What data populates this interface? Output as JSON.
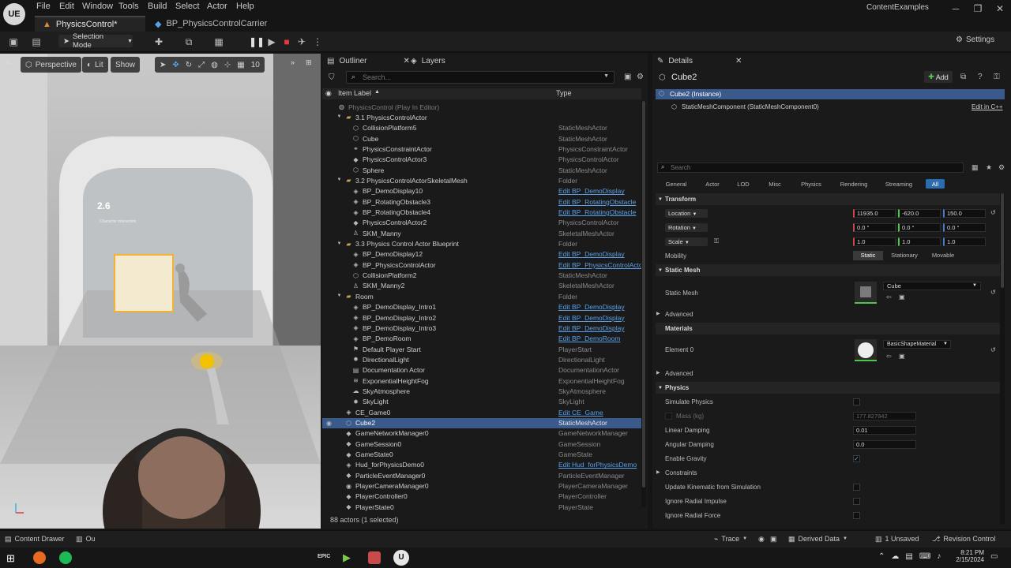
{
  "app": {
    "project_name": "ContentExamples",
    "logo_text": "UE"
  },
  "menu": [
    "File",
    "Edit",
    "Window",
    "Tools",
    "Build",
    "Select",
    "Actor",
    "Help"
  ],
  "tabs": [
    {
      "label": "PhysicsControl*"
    },
    {
      "label": "BP_PhysicsControlCarrier"
    }
  ],
  "toolbar": {
    "mode": "Selection Mode",
    "settings": "Settings"
  },
  "viewport": {
    "perspective": "Perspective",
    "lit": "Lit",
    "show": "Show",
    "grid_size": "10",
    "screen_number": "2.6",
    "screen_heading": "Character interaction"
  },
  "outliner": {
    "tab_label": "Outliner",
    "layers_label": "Layers",
    "search_placeholder": "Search...",
    "col_label": "Item Label",
    "col_type": "Type",
    "status": "88 actors (1 selected)",
    "rows": [
      {
        "label": "PhysicsControl (Play In Editor)",
        "type": "",
        "link": false,
        "indent": 0,
        "icon": "world",
        "selected": false,
        "dim": true
      },
      {
        "label": "3.1 PhysicsControlActor",
        "type": "",
        "link": false,
        "indent": 1,
        "icon": "folder",
        "selected": false,
        "dim": false
      },
      {
        "label": "CollisionPlatform5",
        "type": "StaticMeshActor",
        "link": false,
        "indent": 2,
        "icon": "mesh",
        "selected": false,
        "dim": false
      },
      {
        "label": "Cube",
        "type": "StaticMeshActor",
        "link": false,
        "indent": 2,
        "icon": "mesh",
        "selected": false,
        "dim": false
      },
      {
        "label": "PhysicsConstraintActor",
        "type": "PhysicsConstraintActor",
        "link": false,
        "indent": 2,
        "icon": "constraint",
        "selected": false,
        "dim": false
      },
      {
        "label": "PhysicsControlActor3",
        "type": "PhysicsControlActor",
        "link": false,
        "indent": 2,
        "icon": "actor",
        "selected": false,
        "dim": false
      },
      {
        "label": "Sphere",
        "type": "StaticMeshActor",
        "link": false,
        "indent": 2,
        "icon": "mesh",
        "selected": false,
        "dim": false
      },
      {
        "label": "3.2 PhysicsControlActorSkeletalMesh",
        "type": "Folder",
        "link": false,
        "indent": 1,
        "icon": "folder",
        "selected": false,
        "dim": false
      },
      {
        "label": "BP_DemoDisplay10",
        "type": "Edit BP_DemoDisplay",
        "link": true,
        "indent": 2,
        "icon": "bp",
        "selected": false,
        "dim": false
      },
      {
        "label": "BP_RotatingObstacle3",
        "type": "Edit BP_RotatingObstacle",
        "link": true,
        "indent": 2,
        "icon": "bp",
        "selected": false,
        "dim": false
      },
      {
        "label": "BP_RotatingObstacle4",
        "type": "Edit BP_RotatingObstacle",
        "link": true,
        "indent": 2,
        "icon": "bp",
        "selected": false,
        "dim": false
      },
      {
        "label": "PhysicsControlActor2",
        "type": "PhysicsControlActor",
        "link": false,
        "indent": 2,
        "icon": "actor",
        "selected": false,
        "dim": false
      },
      {
        "label": "SKM_Manny",
        "type": "SkeletalMeshActor",
        "link": false,
        "indent": 2,
        "icon": "skel",
        "selected": false,
        "dim": false
      },
      {
        "label": "3.3 Physics Control Actor Blueprint",
        "type": "Folder",
        "link": false,
        "indent": 1,
        "icon": "folder",
        "selected": false,
        "dim": false
      },
      {
        "label": "BP_DemoDisplay12",
        "type": "Edit BP_DemoDisplay",
        "link": true,
        "indent": 2,
        "icon": "bp",
        "selected": false,
        "dim": false
      },
      {
        "label": "BP_PhysicsControlActor",
        "type": "Edit BP_PhysicsControlActo",
        "link": true,
        "indent": 2,
        "icon": "bp",
        "selected": false,
        "dim": false
      },
      {
        "label": "CollisionPlatform2",
        "type": "StaticMeshActor",
        "link": false,
        "indent": 2,
        "icon": "mesh",
        "selected": false,
        "dim": false
      },
      {
        "label": "SKM_Manny2",
        "type": "SkeletalMeshActor",
        "link": false,
        "indent": 2,
        "icon": "skel",
        "selected": false,
        "dim": false
      },
      {
        "label": "Room",
        "type": "Folder",
        "link": false,
        "indent": 1,
        "icon": "folder",
        "selected": false,
        "dim": false
      },
      {
        "label": "BP_DemoDisplay_Intro1",
        "type": "Edit BP_DemoDisplay",
        "link": true,
        "indent": 2,
        "icon": "bp",
        "selected": false,
        "dim": false
      },
      {
        "label": "BP_DemoDisplay_Intro2",
        "type": "Edit BP_DemoDisplay",
        "link": true,
        "indent": 2,
        "icon": "bp",
        "selected": false,
        "dim": false
      },
      {
        "label": "BP_DemoDisplay_Intro3",
        "type": "Edit BP_DemoDisplay",
        "link": true,
        "indent": 2,
        "icon": "bp",
        "selected": false,
        "dim": false
      },
      {
        "label": "BP_DemoRoom",
        "type": "Edit BP_DemoRoom",
        "link": true,
        "indent": 2,
        "icon": "bp",
        "selected": false,
        "dim": false
      },
      {
        "label": "Default Player Start",
        "type": "PlayerStart",
        "link": false,
        "indent": 2,
        "icon": "start",
        "selected": false,
        "dim": false
      },
      {
        "label": "DirectionalLight",
        "type": "DirectionalLight",
        "link": false,
        "indent": 2,
        "icon": "light",
        "selected": false,
        "dim": false
      },
      {
        "label": "Documentation Actor",
        "type": "DocumentationActor",
        "link": false,
        "indent": 2,
        "icon": "doc",
        "selected": false,
        "dim": false
      },
      {
        "label": "ExponentialHeightFog",
        "type": "ExponentialHeightFog",
        "link": false,
        "indent": 2,
        "icon": "fog",
        "selected": false,
        "dim": false
      },
      {
        "label": "SkyAtmosphere",
        "type": "SkyAtmosphere",
        "link": false,
        "indent": 2,
        "icon": "sky",
        "selected": false,
        "dim": false
      },
      {
        "label": "SkyLight",
        "type": "SkyLight",
        "link": false,
        "indent": 2,
        "icon": "light",
        "selected": false,
        "dim": false
      },
      {
        "label": "CE_Game0",
        "type": "Edit CE_Game",
        "link": true,
        "indent": 1,
        "icon": "bp",
        "selected": false,
        "dim": false
      },
      {
        "label": "Cube2",
        "type": "StaticMeshActor",
        "link": false,
        "indent": 1,
        "icon": "mesh",
        "selected": true,
        "dim": false
      },
      {
        "label": "GameNetworkManager0",
        "type": "GameNetworkManager",
        "link": false,
        "indent": 1,
        "icon": "actor",
        "selected": false,
        "dim": false
      },
      {
        "label": "GameSession0",
        "type": "GameSession",
        "link": false,
        "indent": 1,
        "icon": "actor",
        "selected": false,
        "dim": false
      },
      {
        "label": "GameState0",
        "type": "GameState",
        "link": false,
        "indent": 1,
        "icon": "actor",
        "selected": false,
        "dim": false
      },
      {
        "label": "Hud_forPhysicsDemo0",
        "type": "Edit Hud_forPhysicsDemo",
        "link": true,
        "indent": 1,
        "icon": "bp",
        "selected": false,
        "dim": false
      },
      {
        "label": "ParticleEventManager0",
        "type": "ParticleEventManager",
        "link": false,
        "indent": 1,
        "icon": "actor",
        "selected": false,
        "dim": false
      },
      {
        "label": "PlayerCameraManager0",
        "type": "PlayerCameraManager",
        "link": false,
        "indent": 1,
        "icon": "camera",
        "selected": false,
        "dim": false
      },
      {
        "label": "PlayerController0",
        "type": "PlayerController",
        "link": false,
        "indent": 1,
        "icon": "actor",
        "selected": false,
        "dim": false
      },
      {
        "label": "PlayerState0",
        "type": "PlayerState",
        "link": false,
        "indent": 1,
        "icon": "actor",
        "selected": false,
        "dim": false
      }
    ]
  },
  "details": {
    "tab_label": "Details",
    "object_name": "Cube2",
    "add_label": "Add",
    "instance_label": "Cube2 (Instance)",
    "component_label": "StaticMeshComponent (StaticMeshComponent0)",
    "edit_cpp": "Edit in C++",
    "search_placeholder": "Search",
    "filters": [
      "General",
      "Actor",
      "LOD",
      "Misc",
      "Physics",
      "Rendering",
      "Streaming",
      "All"
    ],
    "transform": {
      "section": "Transform",
      "location_label": "Location",
      "location": [
        "11935.0",
        "-620.0",
        "150.0"
      ],
      "rotation_label": "Rotation",
      "rotation": [
        "0.0 °",
        "0.0 °",
        "0.0 °"
      ],
      "scale_label": "Scale",
      "scale": [
        "1.0",
        "1.0",
        "1.0"
      ],
      "mobility_label": "Mobility",
      "mobility": [
        "Static",
        "Stationary",
        "Movable"
      ]
    },
    "static_mesh": {
      "section": "Static Mesh",
      "label": "Static Mesh",
      "value": "Cube",
      "advanced": "Advanced"
    },
    "materials": {
      "section": "Materials",
      "element_label": "Element 0",
      "value": "BasicShapeMaterial",
      "advanced": "Advanced"
    },
    "physics": {
      "section": "Physics",
      "simulate": "Simulate Physics",
      "mass": "Mass (kg)",
      "mass_value": "177.827942",
      "linear_damping": "Linear Damping",
      "linear_damping_value": "0.01",
      "angular_damping": "Angular Damping",
      "angular_damping_value": "0.0",
      "enable_gravity": "Enable Gravity",
      "constraints": "Constraints",
      "update_kinematic": "Update Kinematic from Simulation",
      "ignore_radial_impulse": "Ignore Radial Impulse",
      "ignore_radial_force": "Ignore Radial Force"
    }
  },
  "statusbar": {
    "content_drawer": "Content Drawer",
    "output_log": "Ou",
    "trace": "Trace",
    "derived_data": "Derived Data",
    "unsaved": "1 Unsaved",
    "revision_control": "Revision Control"
  },
  "taskbar": {
    "time": "8:21 PM",
    "date": "2/15/2024",
    "epic_label": "EPIC"
  },
  "colors": {
    "accent": "#2b6cb0",
    "selection": "#3a5a8c",
    "link": "#5aa0e6",
    "folder": "#c8a45a"
  }
}
